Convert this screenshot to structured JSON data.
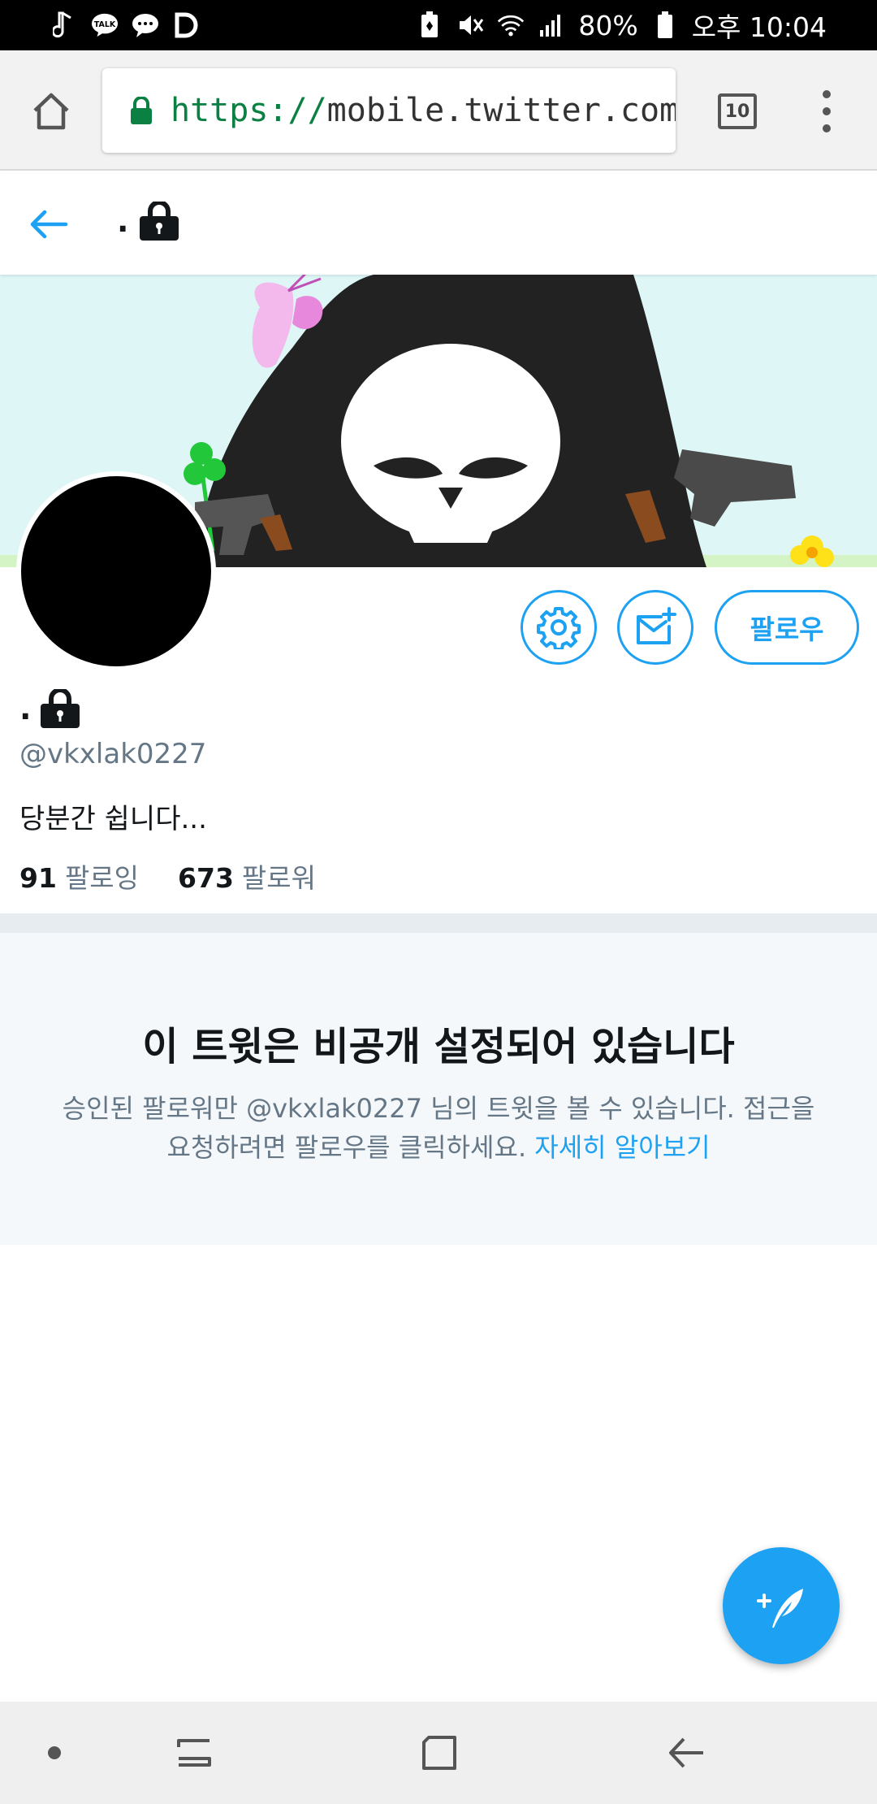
{
  "status_bar": {
    "battery": "80%",
    "time": "오후 10:04",
    "talk_badge": "TALK",
    "icons": [
      "music-note-icon",
      "kakaotalk-icon",
      "chat-bubble-icon",
      "d-app-icon",
      "battery-saver-icon",
      "mute-icon",
      "wifi-icon",
      "signal-icon",
      "battery-icon"
    ]
  },
  "browser": {
    "url_scheme": "https://",
    "url_rest": "mobile.twitter.com/v",
    "tab_count": "10",
    "icons": [
      "home-icon",
      "lock-icon",
      "more-vert-icon"
    ]
  },
  "header": {
    "title": "."
  },
  "profile": {
    "name": ".",
    "handle": "@vkxlak0227",
    "bio": "당분간 쉽니다...",
    "following_count": "91",
    "following_label": "팔로잉",
    "followers_count": "673",
    "followers_label": "팔로워",
    "follow_button": "팔로우"
  },
  "protected": {
    "title": "이 트윗은 비공개 설정되어 있습니다",
    "desc_line1": "승인된 팔로워만 @vkxlak0227 님의 트윗을 볼 수 있습니다. 접근을",
    "desc_line2": "요청하려면 팔로우를 클릭하세요.",
    "learn_more": "자세히 알아보기"
  },
  "colors": {
    "accent": "#1da1f2",
    "banner_bg": "#def6f6",
    "notice_bg": "#f5f8fa",
    "divider": "#e6ecf0",
    "secure_green": "#0b8043"
  }
}
